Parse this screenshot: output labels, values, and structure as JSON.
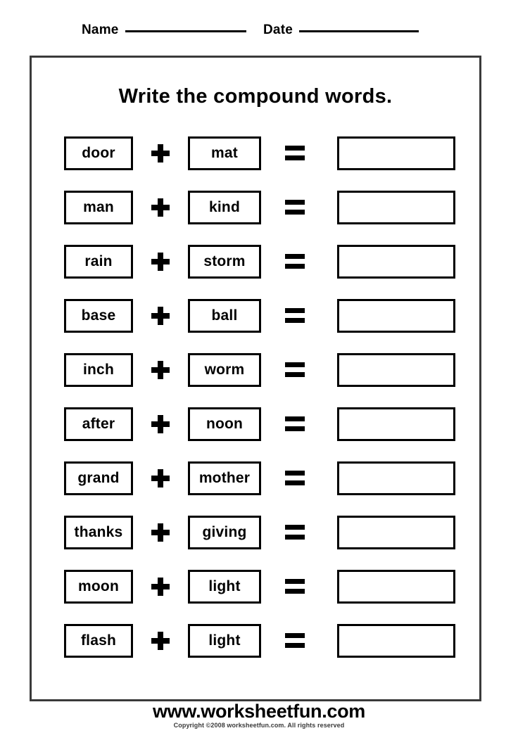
{
  "header": {
    "name_label": "Name",
    "date_label": "Date"
  },
  "sheet": {
    "title": "Write the compound words.",
    "plus_symbol": "+",
    "equals_symbol": "=",
    "rows": [
      {
        "first": "door",
        "second": "mat",
        "answer": ""
      },
      {
        "first": "man",
        "second": "kind",
        "answer": ""
      },
      {
        "first": "rain",
        "second": "storm",
        "answer": ""
      },
      {
        "first": "base",
        "second": "ball",
        "answer": ""
      },
      {
        "first": "inch",
        "second": "worm",
        "answer": ""
      },
      {
        "first": "after",
        "second": "noon",
        "answer": ""
      },
      {
        "first": "grand",
        "second": "mother",
        "answer": ""
      },
      {
        "first": "thanks",
        "second": "giving",
        "answer": ""
      },
      {
        "first": "moon",
        "second": "light",
        "answer": ""
      },
      {
        "first": "flash",
        "second": "light",
        "answer": ""
      }
    ]
  },
  "footer": {
    "site_url": "www.worksheetfun.com",
    "copyright": "Copyright ©2008 worksheetfun.com. All rights reserved"
  }
}
